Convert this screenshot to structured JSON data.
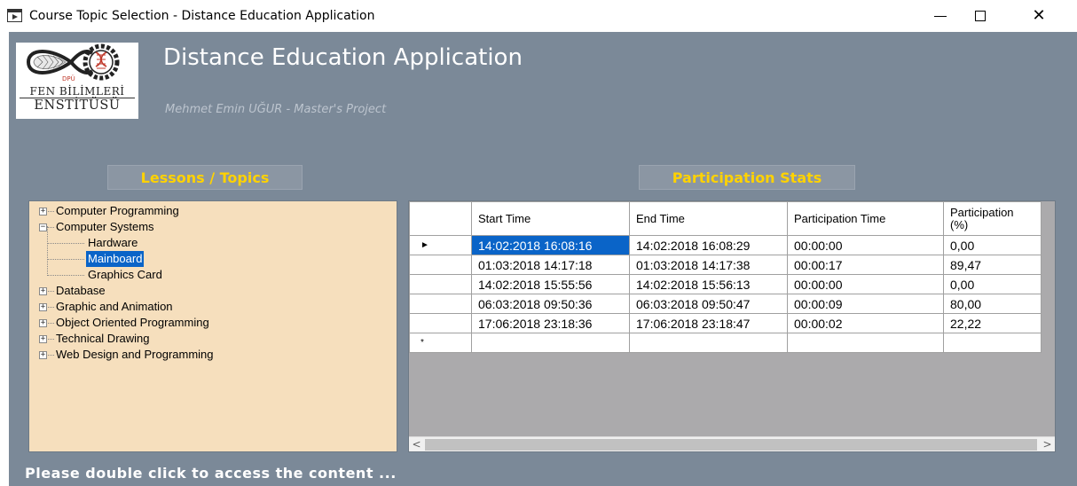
{
  "window": {
    "title": "Course Topic Selection - Distance Education Application",
    "close_glyph": "✕"
  },
  "logo": {
    "line1": "DPÜ",
    "line2": "FEN BİLİMLERİ",
    "line3": "ENSTİTÜSÜ"
  },
  "header": {
    "title": "Distance Education Application",
    "subtitle": "Mehmet Emin UĞUR - Master's Project"
  },
  "sections": {
    "lessons": "Lessons / Topics",
    "stats": "Participation Stats"
  },
  "tree": {
    "nodes": [
      {
        "label": "Computer Programming",
        "expander": "+"
      },
      {
        "label": "Computer Systems",
        "expander": "−"
      },
      {
        "label": "Hardware"
      },
      {
        "label": "Mainboard",
        "selected": true
      },
      {
        "label": "Graphics Card"
      },
      {
        "label": "Database",
        "expander": "+"
      },
      {
        "label": "Graphic and Animation",
        "expander": "+"
      },
      {
        "label": "Object Oriented Programming",
        "expander": "+"
      },
      {
        "label": "Technical Drawing",
        "expander": "+"
      },
      {
        "label": "Web Design and Programming",
        "expander": "+"
      }
    ]
  },
  "grid": {
    "columns": [
      "Start Time",
      "End Time",
      "Participation Time",
      "Participation (%)"
    ],
    "current_row_marker": "►",
    "new_row_marker": "*",
    "rows": [
      [
        "14:02:2018 16:08:16",
        "14:02:2018 16:08:29",
        "00:00:00",
        "0,00"
      ],
      [
        "01:03:2018 14:17:18",
        "01:03:2018 14:17:38",
        "00:00:17",
        "89,47"
      ],
      [
        "14:02:2018 15:55:56",
        "14:02:2018 15:56:13",
        "00:00:00",
        "0,00"
      ],
      [
        "06:03:2018 09:50:36",
        "06:03:2018 09:50:47",
        "00:00:09",
        "80,00"
      ],
      [
        "17:06:2018 23:18:36",
        "17:06:2018 23:18:47",
        "00:00:02",
        "22,22"
      ]
    ],
    "scroll_left": "<",
    "scroll_right": ">"
  },
  "hint": "Please double click to access the content ...",
  "colors": {
    "client_bg": "#7b8998",
    "tree_bg": "#f6dfbd",
    "section_label_text": "#ffd200",
    "selection": "#0a64c8"
  }
}
